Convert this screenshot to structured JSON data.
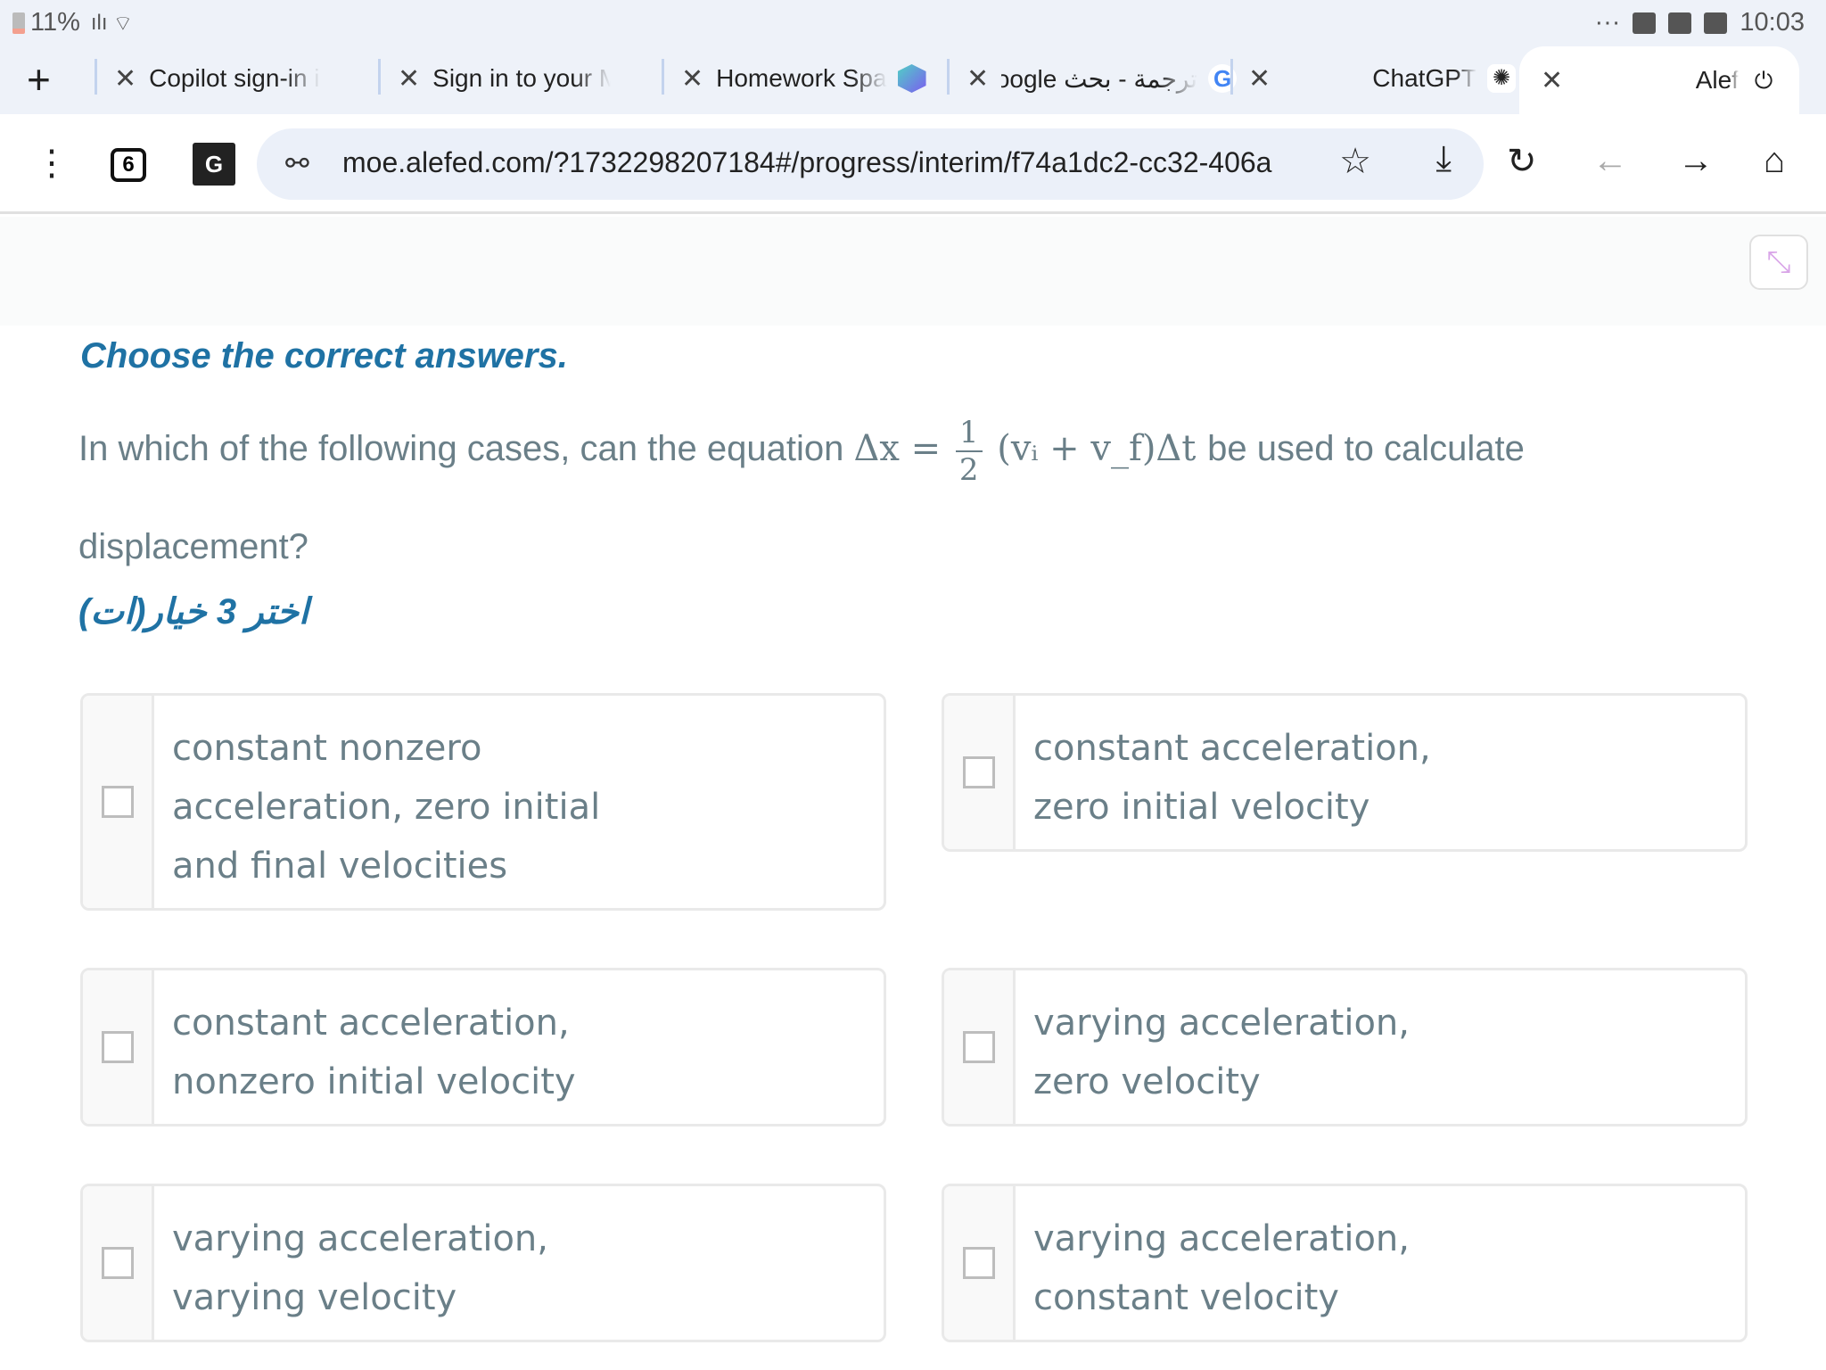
{
  "status_bar": {
    "battery": "11%",
    "time": "10:03",
    "overflow": "···"
  },
  "tabs": [
    {
      "label": "Copilot sign-in i",
      "favicon": "microsoft-icon"
    },
    {
      "label": "Sign in to your M",
      "favicon": "microsoft-icon"
    },
    {
      "label": "Homework Spa",
      "favicon": "homework-app-icon"
    },
    {
      "label": "ترجمة - بحث Google",
      "favicon": "google-icon"
    },
    {
      "label": "ChatGPT",
      "favicon": "openai-icon"
    },
    {
      "label": "Alef",
      "favicon": "alef-icon",
      "active": true
    }
  ],
  "toolbar": {
    "tab_count": "6",
    "url": "moe.alefed.com/?1732298207184#/progress/interim/f74a1dc2-cc32-406a"
  },
  "page": {
    "heading": "Choose the correct answers.",
    "question_before": "In which of the following cases, can the equation",
    "equation": {
      "lhs": "Δx =",
      "frac_num": "1",
      "frac_den": "2",
      "rhs": "(vᵢ + v_f)Δt"
    },
    "question_after": "be used to calculate displacement?",
    "instruction_ar": "اختر 3 خيار(ات)",
    "options": [
      {
        "text": "constant nonzero acceleration, zero initial and final velocities",
        "checked": false
      },
      {
        "text": "constant acceleration, zero initial velocity",
        "checked": false
      },
      {
        "text": "constant acceleration, nonzero initial velocity",
        "checked": false
      },
      {
        "text": "varying acceleration, zero velocity",
        "checked": false
      },
      {
        "text": "varying acceleration, varying velocity",
        "checked": false
      },
      {
        "text": "varying acceleration, constant velocity",
        "checked": false
      }
    ]
  },
  "colors": {
    "heading": "#1f72a4",
    "body_text": "#6a7f88",
    "collapse_icon": "#d9a6e8"
  }
}
